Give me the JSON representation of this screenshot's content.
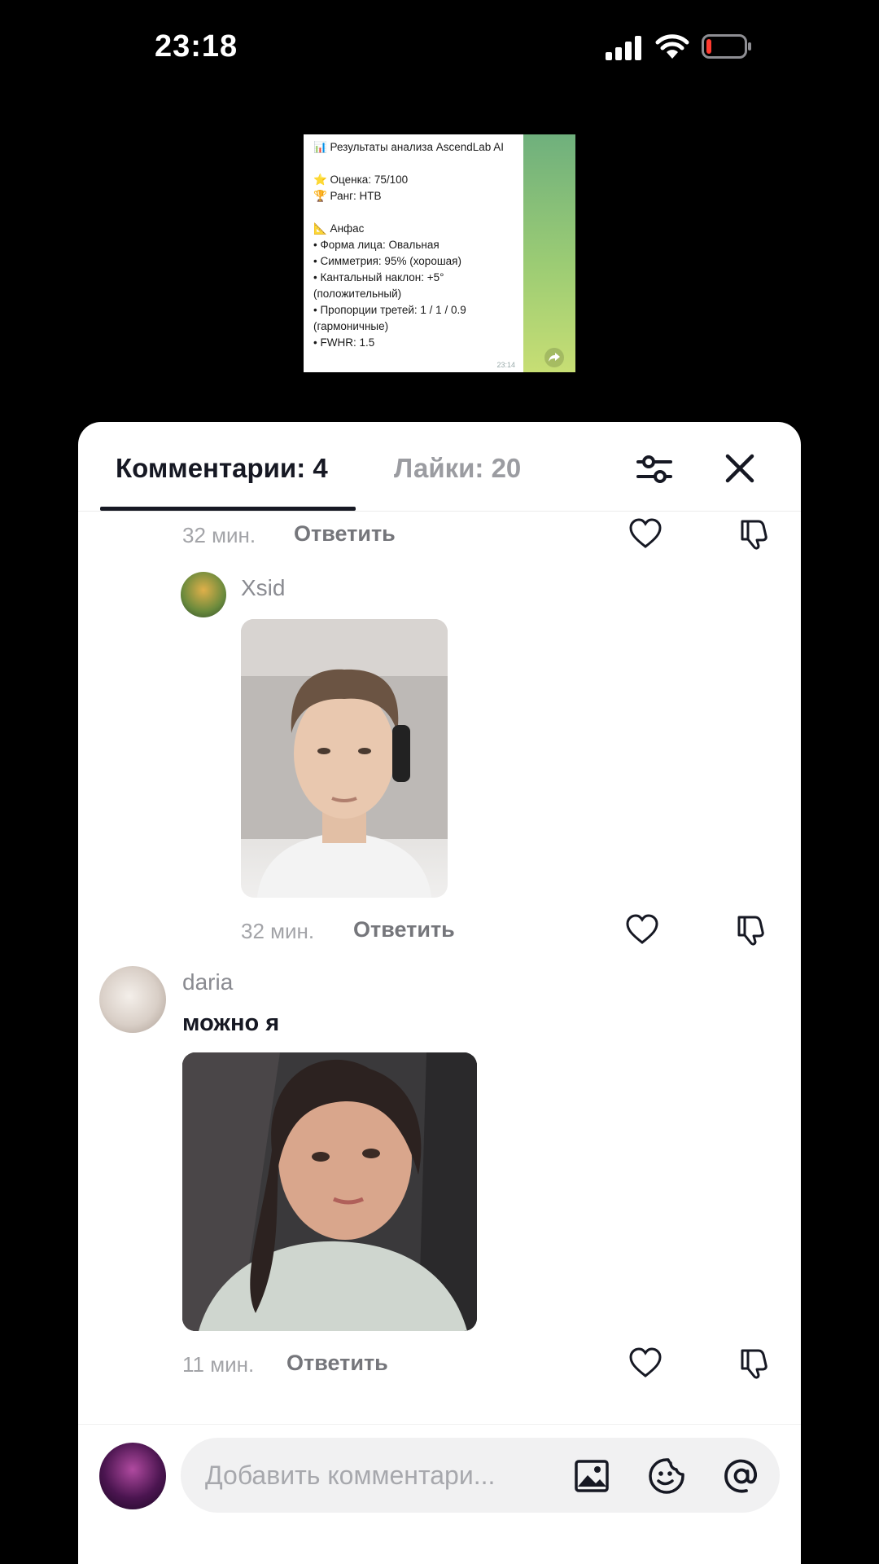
{
  "status_bar": {
    "time": "23:18"
  },
  "telegram_preview": {
    "lines": [
      "📊 Результаты анализа AscendLab AI",
      "",
      "⭐ Оценка: 75/100",
      "🏆 Ранг: HTB",
      "",
      "📐 Анфас",
      "• Форма лица: Овальная",
      "• Симметрия: 95% (хорошая)",
      "• Кантальный наклон: +5° (положительный)",
      "• Пропорции третей: 1 / 1 / 0.9 (гармоничные)",
      "• FWHR: 1.5"
    ],
    "time": "23:14"
  },
  "tabs": {
    "comments": "Комментарии: 4",
    "likes": "Лайки: 20"
  },
  "comments": [
    {
      "time": "32 мин.",
      "reply": "Ответить"
    },
    {
      "username": "Xsid",
      "time": "32 мин.",
      "reply": "Ответить"
    },
    {
      "username": "daria",
      "text": "можно я",
      "time": "11 мин.",
      "reply": "Ответить"
    }
  ],
  "input": {
    "placeholder": "Добавить комментари..."
  },
  "colors": {
    "sheet_bg": "#ffffff",
    "text_primary": "#161823",
    "text_muted": "#a3a4a8"
  }
}
